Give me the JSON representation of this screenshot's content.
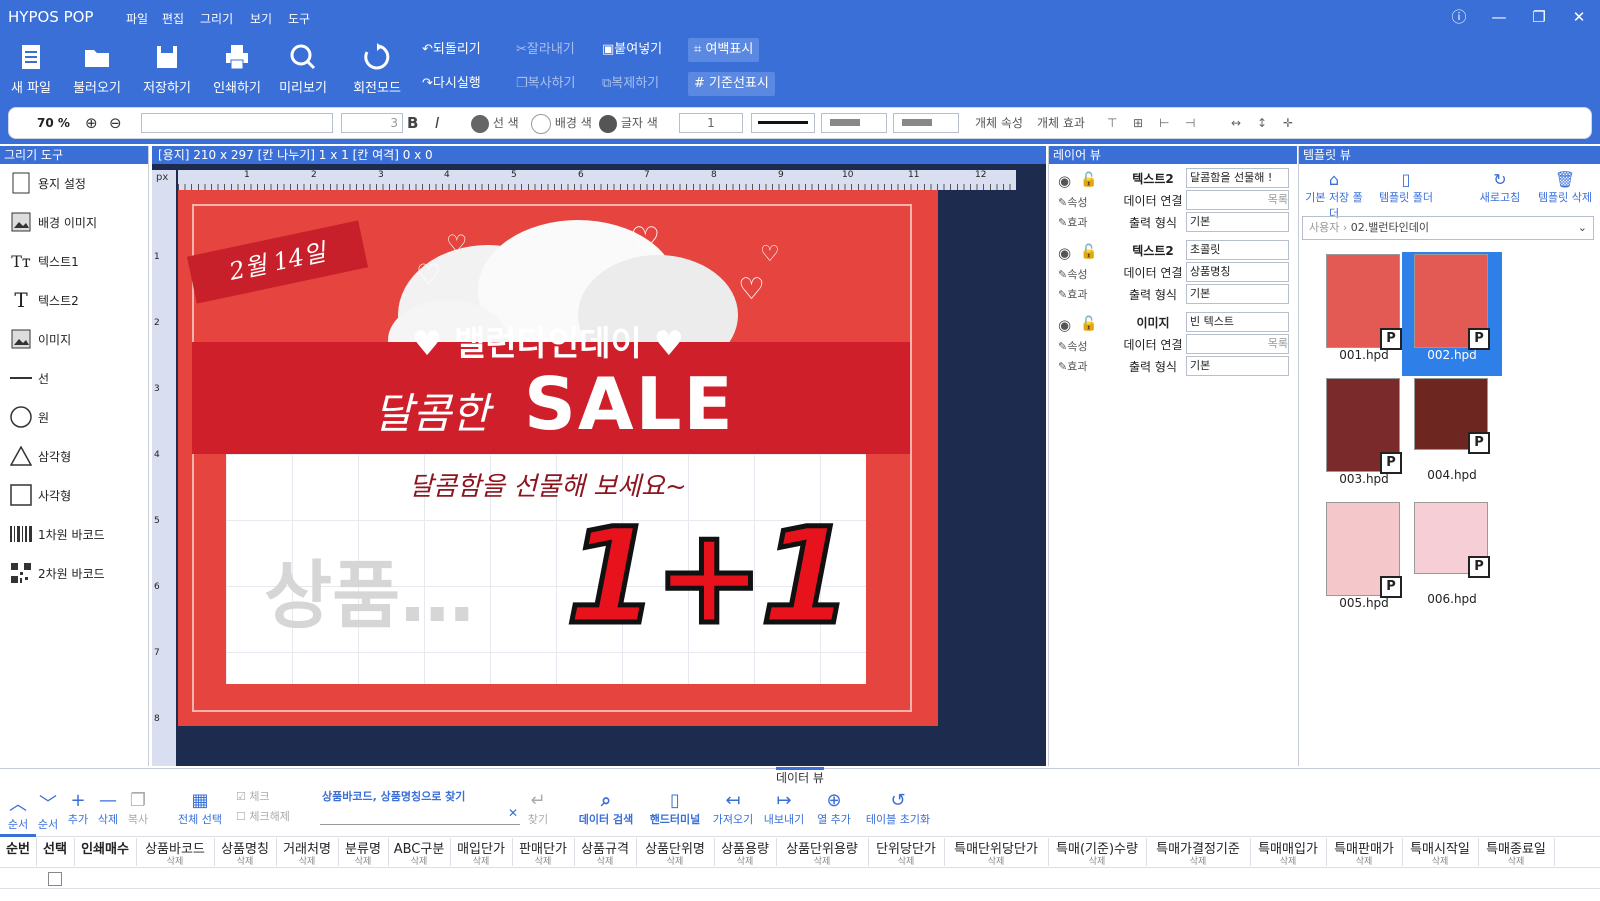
{
  "app": {
    "title": "HYPOS POP",
    "menu": [
      "파일",
      "편집",
      "그리기",
      "보기",
      "도구"
    ]
  },
  "ribbon": {
    "buttons": [
      "새 파일",
      "불러오기",
      "저장하기",
      "인쇄하기",
      "미리보기",
      "회전모드"
    ],
    "undo": "되돌리기",
    "redo": "다시실행",
    "cut": "잘라내기",
    "copy": "복사하기",
    "paste": "붙여넣기",
    "duplicate": "복제하기",
    "margin": "여백표시",
    "guide": "기준선표시"
  },
  "toolbar": {
    "zoom": "70 %",
    "font_size": "3",
    "line_color": "선 색",
    "bg_color": "배경 색",
    "text_color": "글자 색",
    "line_width": "1",
    "obj_props": "개체 속성",
    "obj_effect": "개체 효과"
  },
  "left_panel": {
    "title": "그리기 도구",
    "tools": [
      "용지 설정",
      "배경 이미지",
      "텍스트1",
      "텍스트2",
      "이미지",
      "선",
      "원",
      "삼각형",
      "사각형",
      "1차원 바코드",
      "2차원 바코드"
    ]
  },
  "canvas": {
    "info": "[용지] 210 x 297  [칸 나누기] 1 x 1  [칸 여격] 0 x 0",
    "ruler_unit": "px",
    "ruler_top": [
      "1",
      "2",
      "3",
      "4",
      "5",
      "6",
      "7",
      "8",
      "9",
      "10",
      "11",
      "12"
    ],
    "ruler_left": [
      "1",
      "2",
      "3",
      "4",
      "5",
      "6",
      "7",
      "8"
    ],
    "poster": {
      "ribbon_text": "2월 14일",
      "title_line1": "♥ 밸런타인데이 ♥",
      "title_line2a": "달콤한",
      "title_line2b": "SALE",
      "subtitle": "달콤함을 선물해 보세요~",
      "product": "상품…",
      "promo": "1+1"
    }
  },
  "layer_panel": {
    "title": "레이어 뷰",
    "prop": "속성",
    "effect": "효과",
    "link": "데이터 연결",
    "format": "출력 형식",
    "list": "목록",
    "layers": [
      {
        "name": "텍스트2",
        "value": "달콤함을 선물해 !",
        "link": "",
        "format": "기본"
      },
      {
        "name": "텍스트2",
        "value": "초콜릿",
        "link": "상품명칭",
        "format": "기본"
      },
      {
        "name": "이미지",
        "value": "빈 텍스트",
        "link": "",
        "format": "기본"
      }
    ]
  },
  "template_panel": {
    "title": "템플릿 뷰",
    "actions": [
      "기본 저장 폴더",
      "템플릿 폴더",
      "새로고침",
      "템플릿 삭제"
    ],
    "path": [
      "사용자",
      "02.밸런타인데이"
    ],
    "files": [
      "001.hpd",
      "002.hpd",
      "003.hpd",
      "004.hpd",
      "005.hpd",
      "006.hpd"
    ],
    "badge": "P"
  },
  "data_panel": {
    "title": "데이터 뷰",
    "tools": [
      "순서",
      "순서",
      "추가",
      "삭제",
      "복사",
      "전체 선택",
      "체크",
      "체크해제"
    ],
    "search_label": "상품바코드, 상품명칭으로 찾기",
    "search_btn": "찾기",
    "actions": [
      "데이터 검색",
      "핸드터미널",
      "가져오기",
      "내보내기",
      "열 추가",
      "테이블 초기화"
    ],
    "columns": [
      "순번",
      "선택",
      "인쇄매수",
      "상품바코드",
      "상품명칭",
      "거래처명",
      "분류명",
      "ABC구분",
      "매입단가",
      "판매단가",
      "상품규격",
      "상품단위명",
      "상품용량",
      "상품단위용량",
      "단위당단가",
      "특매단위당단가",
      "특매(기준)수량",
      "특매가결정기준",
      "특매매입가",
      "특매판매가",
      "특매시작일",
      "특매종료일"
    ],
    "col_sub": "삭제"
  },
  "colors": {
    "accent": "#3a6fd8",
    "canvas_bg": "#1c2b4e",
    "poster_red": "#e03a36"
  }
}
